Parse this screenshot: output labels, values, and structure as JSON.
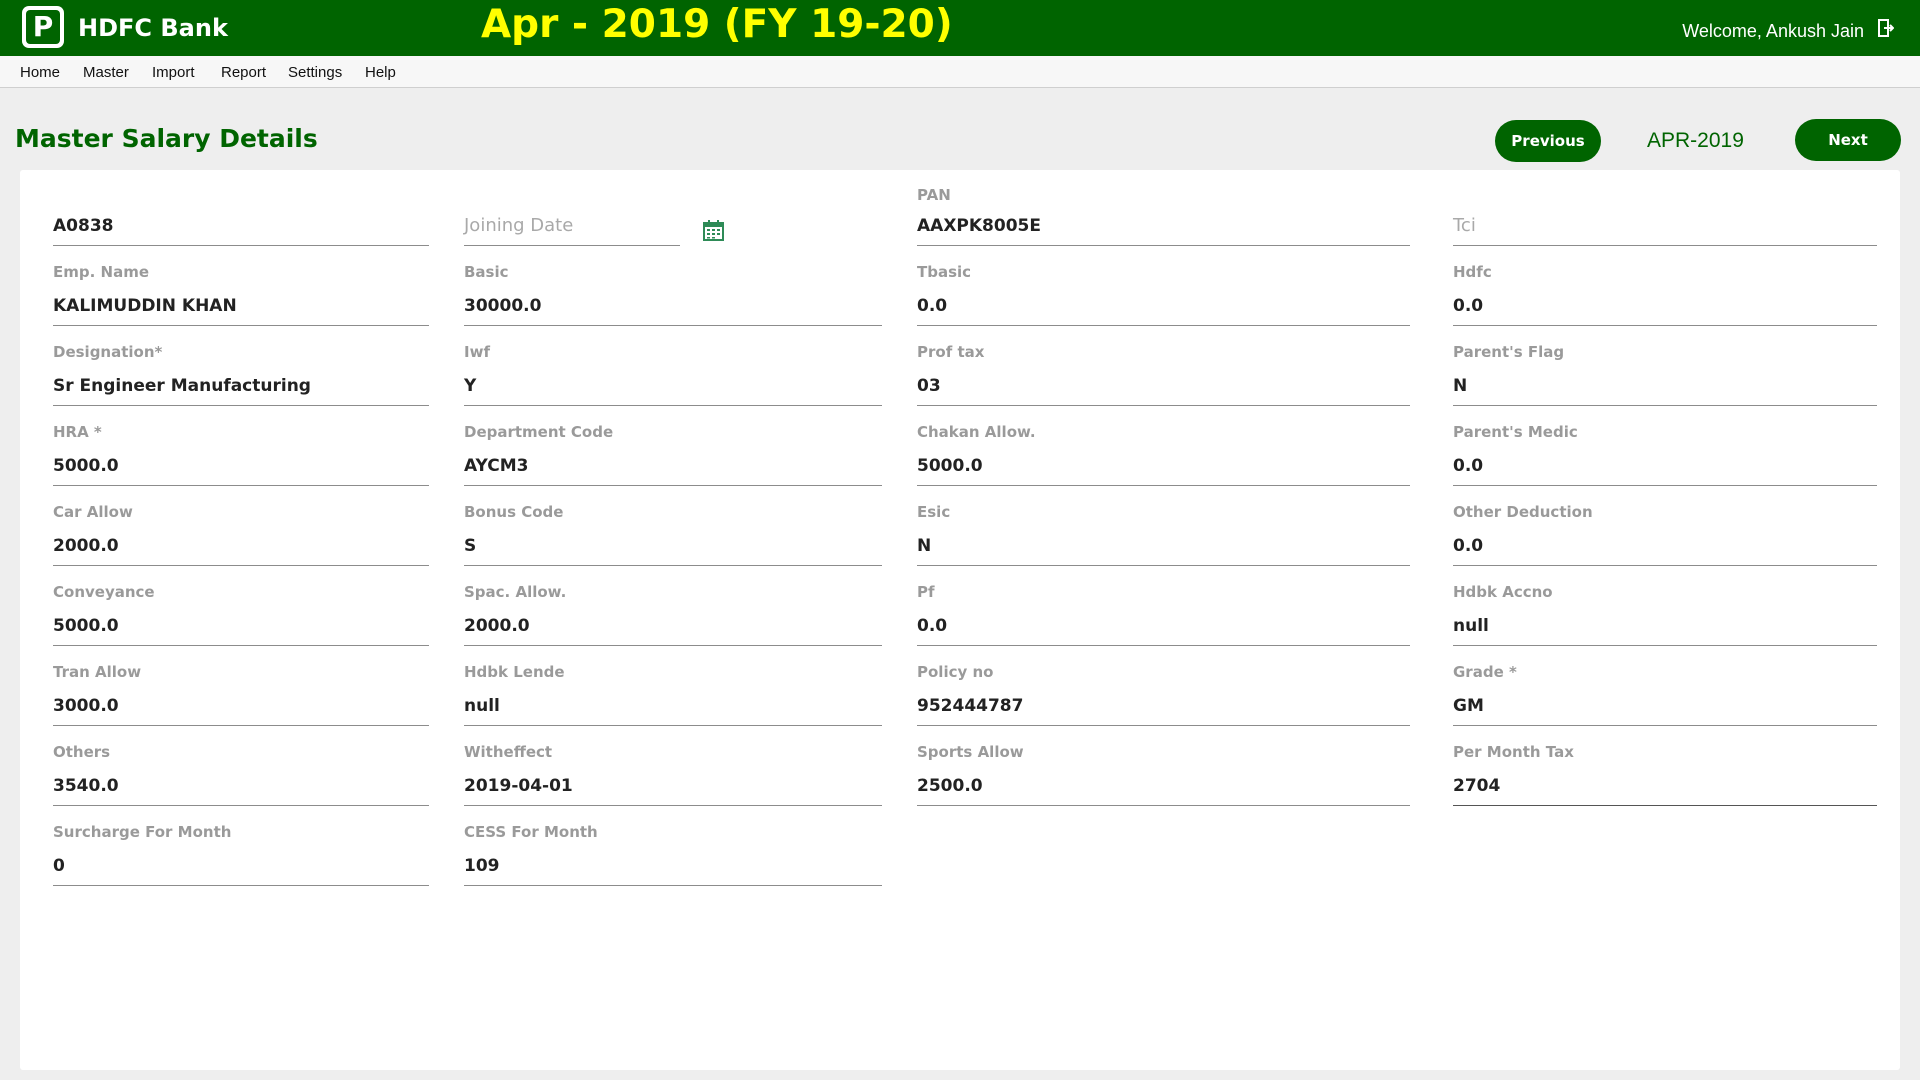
{
  "header": {
    "logo_letter": "P",
    "brand": "HDFC Bank",
    "period": "Apr - 2019 (FY 19-20)",
    "welcome": "Welcome, Ankush Jain",
    "logout_icon": "logout-icon"
  },
  "menu": [
    "Home",
    "Master",
    "Import",
    "Report",
    "Settings",
    "Help"
  ],
  "page": {
    "title": "Master Salary Details",
    "prev_label": "Previous",
    "month": "APR-2019",
    "next_label": "Next"
  },
  "form": {
    "emp_code": {
      "label": "",
      "value": "A0838"
    },
    "joining_date": {
      "label": "",
      "placeholder": "Joining Date",
      "value": ""
    },
    "pan": {
      "label": "PAN",
      "value": "AAXPK8005E"
    },
    "tci": {
      "label": "",
      "placeholder": "Tci",
      "value": ""
    },
    "emp_name": {
      "label": "Emp. Name",
      "value": "KALIMUDDIN KHAN"
    },
    "basic": {
      "label": "Basic",
      "value": "30000.0"
    },
    "tbasic": {
      "label": "Tbasic",
      "value": "0.0"
    },
    "hdfc": {
      "label": "Hdfc",
      "value": "0.0"
    },
    "designation": {
      "label": "Designation*",
      "value": "Sr Engineer Manufacturing"
    },
    "iwf": {
      "label": "Iwf",
      "value": "Y"
    },
    "prof_tax": {
      "label": "Prof tax",
      "value": "03"
    },
    "parents_flag": {
      "label": "Parent's Flag",
      "value": "N"
    },
    "hra": {
      "label": "HRA *",
      "value": "5000.0"
    },
    "department_code": {
      "label": "Department Code",
      "value": "AYCM3"
    },
    "chakan_allow": {
      "label": "Chakan Allow.",
      "value": "5000.0"
    },
    "parents_medic": {
      "label": "Parent's Medic",
      "value": "0.0"
    },
    "car_allow": {
      "label": "Car Allow",
      "value": "2000.0"
    },
    "bonus_code": {
      "label": "Bonus Code",
      "value": "S"
    },
    "esic": {
      "label": "Esic",
      "value": "N"
    },
    "other_deduction": {
      "label": "Other Deduction",
      "value": "0.0"
    },
    "conveyance": {
      "label": "Conveyance",
      "value": "5000.0"
    },
    "spac_allow": {
      "label": "Spac. Allow.",
      "value": "2000.0"
    },
    "pf": {
      "label": "Pf",
      "value": "0.0"
    },
    "hdbk_accno": {
      "label": "Hdbk Accno",
      "value": "null"
    },
    "tran_allow": {
      "label": "Tran Allow",
      "value": "3000.0"
    },
    "hdbk_lende": {
      "label": "Hdbk Lende",
      "value": "null"
    },
    "policy_no": {
      "label": "Policy no",
      "value": "952444787"
    },
    "grade": {
      "label": "Grade *",
      "value": "GM"
    },
    "others": {
      "label": "Others",
      "value": "3540.0"
    },
    "witheffect": {
      "label": "Witheffect",
      "value": "2019-04-01"
    },
    "sports_allow": {
      "label": "Sports Allow",
      "value": "2500.0"
    },
    "per_month_tax": {
      "label": "Per Month Tax",
      "value": "2704"
    },
    "surcharge_for_month": {
      "label": "Surcharge For Month",
      "value": "0"
    },
    "cess_for_month": {
      "label": "CESS For Month",
      "value": "109"
    }
  },
  "colors": {
    "brand_green": "#006400",
    "period_yellow": "#ffff00",
    "label_gray": "#9a9a9a"
  }
}
